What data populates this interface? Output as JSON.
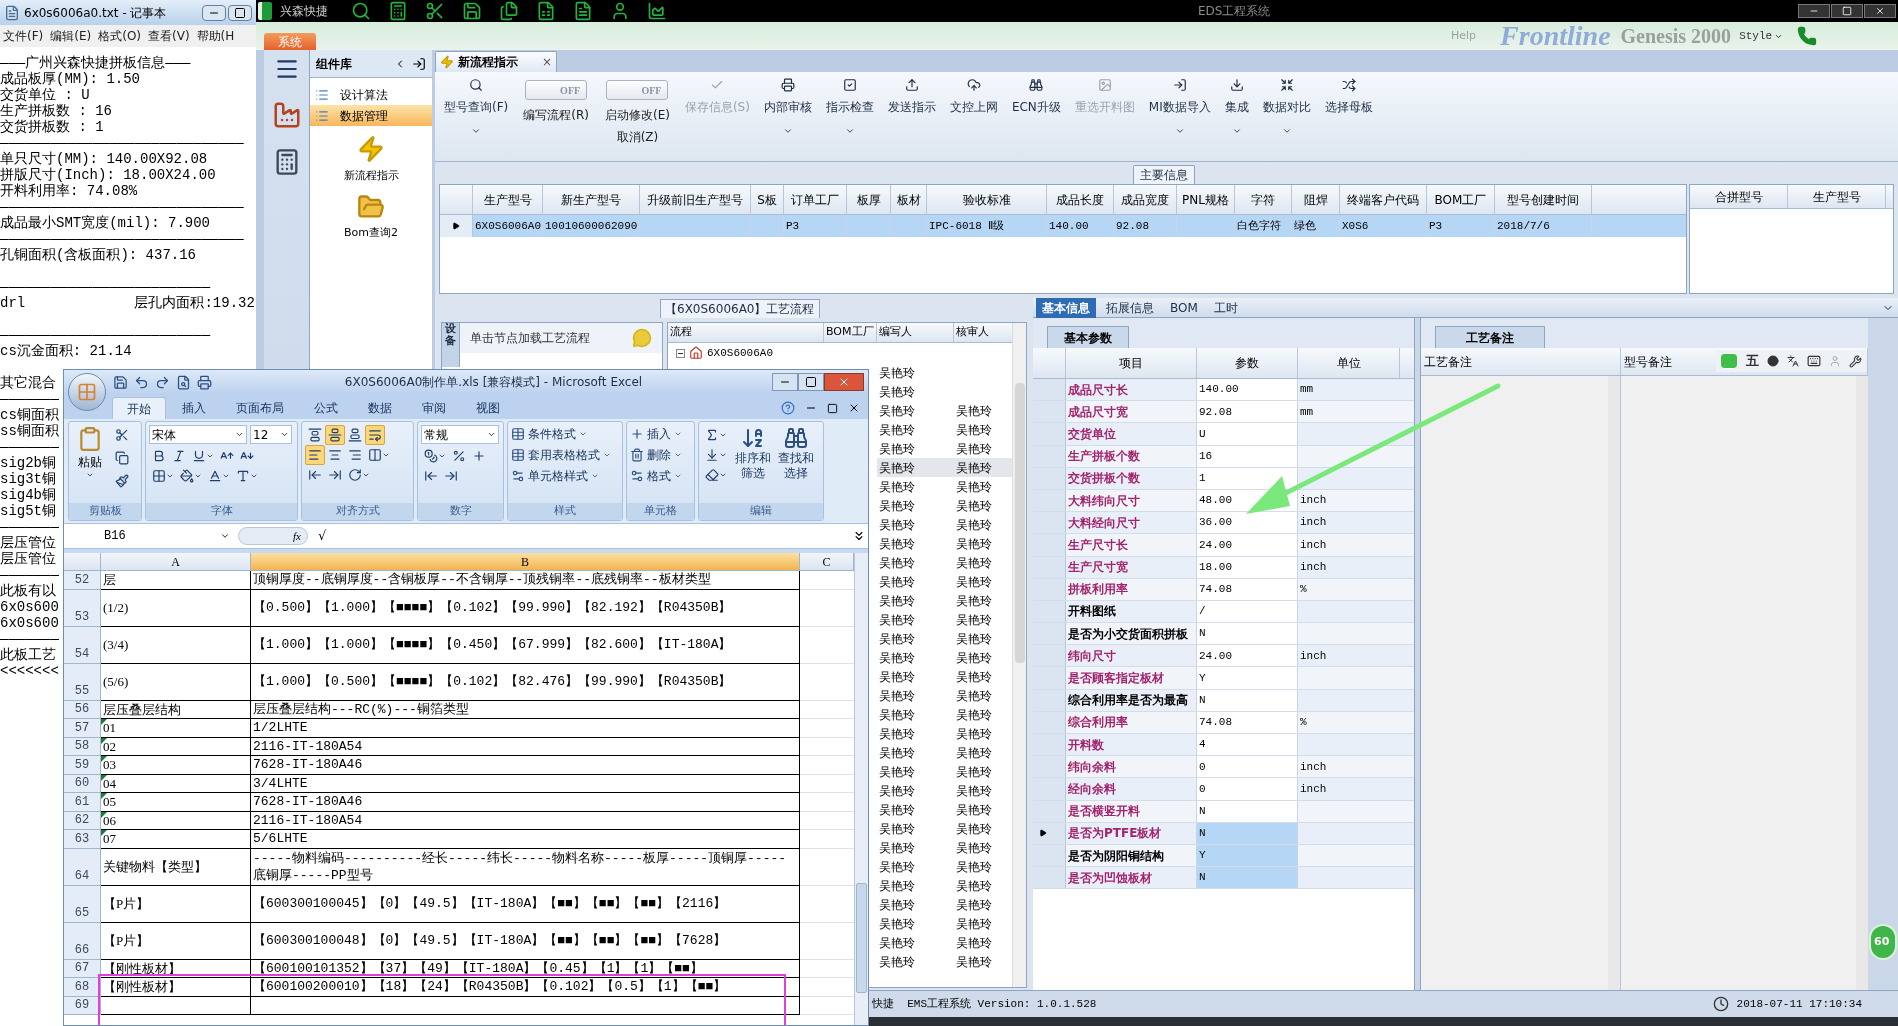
{
  "notepad": {
    "title": "6x0s6006a0.txt - 记事本",
    "menu": [
      "文件(F)",
      "编辑(E)",
      "格式(O)",
      "查看(V)",
      "帮助(H"
    ],
    "lines": [
      {
        "kind": "text",
        "text": "———广州兴森快捷拼板信息———"
      },
      {
        "kind": "text",
        "text": "成品板厚(MM): 1.50"
      },
      {
        "kind": "text",
        "text": "交货单位 : U"
      },
      {
        "kind": "text",
        "text": "生产拼板数 : 16"
      },
      {
        "kind": "text",
        "text": "交货拼板数 : 1"
      },
      {
        "kind": "text",
        "text": "—————————————————————————————"
      },
      {
        "kind": "text",
        "text": "单只尺寸(MM): 140.00X92.08"
      },
      {
        "kind": "text",
        "text": "拼版尺寸(Inch): 18.00X24.00"
      },
      {
        "kind": "text",
        "text": "开料利用率: 74.08%"
      },
      {
        "kind": "text",
        "text": "—————————————————————————————"
      },
      {
        "kind": "text",
        "text": "成品最小SMT宽度(mil): 7.900"
      },
      {
        "kind": "text",
        "text": "—————————————————————————————"
      },
      {
        "kind": "text",
        "text": "孔铜面积(含板面积): 437.16"
      },
      {
        "kind": "blank"
      },
      {
        "kind": "text",
        "text": "—————————————————————————"
      },
      {
        "kind": "text",
        "text": "drl             层孔内面积:19.32"
      },
      {
        "kind": "blank"
      },
      {
        "kind": "text",
        "text": "—————————————————————————"
      },
      {
        "kind": "text",
        "text": "cs沉金面积: 21.14"
      },
      {
        "kind": "blank"
      },
      {
        "kind": "text",
        "text": "其它混合"
      },
      {
        "kind": "text",
        "text": "———————"
      },
      {
        "kind": "text",
        "text": "cs铜面积"
      },
      {
        "kind": "text",
        "text": "ss铜面积"
      },
      {
        "kind": "text",
        "text": "———————"
      },
      {
        "kind": "text",
        "text": "sig2b铜"
      },
      {
        "kind": "text",
        "text": "sig3t铜"
      },
      {
        "kind": "text",
        "text": "sig4b铜"
      },
      {
        "kind": "text",
        "text": "sig5t铜"
      },
      {
        "kind": "text",
        "text": "———————"
      },
      {
        "kind": "text",
        "text": "层压管位"
      },
      {
        "kind": "text",
        "text": "层压管位"
      },
      {
        "kind": "text",
        "text": "———————"
      },
      {
        "kind": "text",
        "text": "此板有以"
      },
      {
        "kind": "text",
        "text": "6x0s600"
      },
      {
        "kind": "text",
        "text": "6x0s600"
      },
      {
        "kind": "text",
        "text": "———————"
      },
      {
        "kind": "text",
        "text": "此板工艺"
      },
      {
        "kind": "text",
        "text": "<<<<<<<"
      }
    ]
  },
  "app": {
    "brand": "兴森快捷",
    "window_title": "EDS工程系统",
    "system_tab": "系统",
    "help_menu": "Help",
    "banner_logo": "Frontline",
    "banner_product": "Genesis 2000",
    "style_menu": "Style"
  },
  "component_panel": {
    "title": "组件库",
    "items": [
      {
        "label": "设计算法",
        "selected": false
      },
      {
        "label": "数据管理",
        "selected": true
      }
    ],
    "launchers": [
      "新流程指示",
      "Bom查询2"
    ]
  },
  "document_tab": {
    "label": "新流程指示",
    "close": "×"
  },
  "toolbar": [
    {
      "kind": "button",
      "label": "型号查询(F)",
      "disabled": false,
      "dropdown": true
    },
    {
      "kind": "toggle",
      "label": "编写流程(R)",
      "switch_text": "OFF",
      "on": false
    },
    {
      "kind": "toggle",
      "label": "启动修改(E)",
      "extra_label": "取消(Z)",
      "switch_text": "OFF",
      "on": false
    },
    {
      "kind": "button",
      "label": "保存信息(S)",
      "disabled": true,
      "dropdown": false
    },
    {
      "kind": "button",
      "label": "内部审核",
      "disabled": false,
      "dropdown": true
    },
    {
      "kind": "button",
      "label": "指示检查",
      "disabled": false,
      "dropdown": true
    },
    {
      "kind": "button",
      "label": "发送指示",
      "disabled": false,
      "dropdown": false
    },
    {
      "kind": "button",
      "label": "文控上网",
      "disabled": false,
      "dropdown": false
    },
    {
      "kind": "button",
      "label": "ECN升级",
      "disabled": false,
      "dropdown": false
    },
    {
      "kind": "button",
      "label": "重选开料图",
      "disabled": true,
      "dropdown": false
    },
    {
      "kind": "button",
      "label": "MI数据导入",
      "disabled": false,
      "dropdown": true
    },
    {
      "kind": "button",
      "label": "集成",
      "disabled": false,
      "dropdown": true
    },
    {
      "kind": "button",
      "label": "数据对比",
      "disabled": false,
      "dropdown": true
    },
    {
      "kind": "button",
      "label": "选择母板",
      "disabled": false,
      "dropdown": false
    }
  ],
  "main_info": {
    "title": "主要信息",
    "columns": [
      "生产型号",
      "新生产型号",
      "升级前旧生产型号",
      "S板",
      "订单工厂",
      "板厚",
      "板材",
      "验收标准",
      "成品长度",
      "成品宽度",
      "PNL规格",
      "字符",
      "阻焊",
      "终端客户代码",
      "BOM工厂",
      "型号创建时间"
    ],
    "rows": [
      {
        "selected": true,
        "cells": [
          "6X0S6006A0",
          "10010600062090",
          null,
          null,
          "P3",
          null,
          null,
          "IPC-6018 Ⅱ级",
          "140.00",
          "92.08",
          null,
          "白色字符",
          "绿色",
          "X0S6",
          "P3",
          "2018/7/6"
        ]
      }
    ],
    "side_columns": [
      "合拼型号",
      "生产型号"
    ]
  },
  "process": {
    "title": "【6X0S6006A0】工艺流程",
    "side_tab": "设备",
    "hint": "单击节点加载工艺流程",
    "columns": [
      "流程",
      "BOM工厂",
      "编写人",
      "核审人"
    ],
    "root": {
      "label": "6X0S6006A0",
      "expanded": true
    },
    "rows": [
      {
        "writer": "吴艳玲",
        "reviewer": null,
        "selected": false
      },
      {
        "writer": "吴艳玲",
        "reviewer": null,
        "selected": false
      },
      {
        "writer": "吴艳玲",
        "reviewer": "吴艳玲",
        "selected": false
      },
      {
        "writer": "吴艳玲",
        "reviewer": "吴艳玲",
        "selected": false
      },
      {
        "writer": "吴艳玲",
        "reviewer": "吴艳玲",
        "selected": false
      },
      {
        "writer": "吴艳玲",
        "reviewer": "吴艳玲",
        "selected": true
      },
      {
        "writer": "吴艳玲",
        "reviewer": "吴艳玲",
        "selected": false
      },
      {
        "writer": "吴艳玲",
        "reviewer": "吴艳玲",
        "selected": false
      },
      {
        "writer": "吴艳玲",
        "reviewer": "吴艳玲",
        "selected": false
      },
      {
        "writer": "吴艳玲",
        "reviewer": "吴艳玲",
        "selected": false
      },
      {
        "writer": "吴艳玲",
        "reviewer": "吴艳玲",
        "selected": false
      },
      {
        "writer": "吴艳玲",
        "reviewer": "吴艳玲",
        "selected": false
      },
      {
        "writer": "吴艳玲",
        "reviewer": "吴艳玲",
        "selected": false
      },
      {
        "writer": "吴艳玲",
        "reviewer": "吴艳玲",
        "selected": false
      },
      {
        "writer": "吴艳玲",
        "reviewer": "吴艳玲",
        "selected": false
      },
      {
        "writer": "吴艳玲",
        "reviewer": "吴艳玲",
        "selected": false
      },
      {
        "writer": "吴艳玲",
        "reviewer": "吴艳玲",
        "selected": false
      },
      {
        "writer": "吴艳玲",
        "reviewer": "吴艳玲",
        "selected": false
      },
      {
        "writer": "吴艳玲",
        "reviewer": "吴艳玲",
        "selected": false
      },
      {
        "writer": "吴艳玲",
        "reviewer": "吴艳玲",
        "selected": false
      },
      {
        "writer": "吴艳玲",
        "reviewer": "吴艳玲",
        "selected": false
      },
      {
        "writer": "吴艳玲",
        "reviewer": "吴艳玲",
        "selected": false
      },
      {
        "writer": "吴艳玲",
        "reviewer": "吴艳玲",
        "selected": false
      },
      {
        "writer": "吴艳玲",
        "reviewer": "吴艳玲",
        "selected": false
      },
      {
        "writer": "吴艳玲",
        "reviewer": "吴艳玲",
        "selected": false
      },
      {
        "writer": "吴艳玲",
        "reviewer": "吴艳玲",
        "selected": false
      },
      {
        "writer": "吴艳玲",
        "reviewer": "吴艳玲",
        "selected": false
      },
      {
        "writer": "吴艳玲",
        "reviewer": "吴艳玲",
        "selected": false
      },
      {
        "writer": "吴艳玲",
        "reviewer": "吴艳玲",
        "selected": false
      },
      {
        "writer": "吴艳玲",
        "reviewer": "吴艳玲",
        "selected": false
      },
      {
        "writer": "吴艳玲",
        "reviewer": "吴艳玲",
        "selected": false
      },
      {
        "writer": "吴艳玲",
        "reviewer": "吴艳玲",
        "selected": false
      }
    ]
  },
  "detail_tabs": [
    {
      "label": "基本信息",
      "selected": true
    },
    {
      "label": "拓展信息",
      "selected": false
    },
    {
      "label": "BOM",
      "selected": false
    },
    {
      "label": "工时",
      "selected": false
    }
  ],
  "params": {
    "tab": "基本参数",
    "columns": [
      "项目",
      "参数",
      "单位"
    ],
    "rows": [
      {
        "item": "成品尺寸长",
        "value": "140.00",
        "unit": "mm",
        "color": "#a3246e",
        "selected": false,
        "current": false
      },
      {
        "item": "成品尺寸宽",
        "value": "92.08",
        "unit": "mm",
        "color": "#a3246e",
        "selected": false,
        "current": false
      },
      {
        "item": "交货单位",
        "value": "U",
        "color": "#a3246e",
        "selected": false,
        "current": false
      },
      {
        "item": "生产拼板个数",
        "value": "16",
        "color": "#a3246e",
        "selected": false,
        "current": false
      },
      {
        "item": "交货拼板个数",
        "value": "1",
        "color": "#a3246e",
        "selected": false,
        "current": false
      },
      {
        "item": "大料纬向尺寸",
        "value": "48.00",
        "unit": "inch",
        "color": "#a3246e",
        "selected": false,
        "current": false
      },
      {
        "item": "大料经向尺寸",
        "value": "36.00",
        "unit": "inch",
        "color": "#a3246e",
        "selected": false,
        "current": false
      },
      {
        "item": "生产尺寸长",
        "value": "24.00",
        "unit": "inch",
        "color": "#a3246e",
        "selected": false,
        "current": false
      },
      {
        "item": "生产尺寸宽",
        "value": "18.00",
        "unit": "inch",
        "color": "#a3246e",
        "selected": false,
        "current": false
      },
      {
        "item": "拼板利用率",
        "value": "74.08",
        "unit": "%",
        "color": "#a3246e",
        "selected": false,
        "current": false
      },
      {
        "item": "开料图纸",
        "value": "/",
        "color": "#000000",
        "selected": false,
        "current": false
      },
      {
        "item": "是否为小交货面积拼板",
        "value": "N",
        "color": "#000000",
        "selected": false,
        "current": false
      },
      {
        "item": "纬向尺寸",
        "value": "24.00",
        "unit": "inch",
        "color": "#a3246e",
        "selected": false,
        "current": false
      },
      {
        "item": "是否顾客指定板材",
        "value": "Y",
        "color": "#a3246e",
        "selected": false,
        "current": false
      },
      {
        "item": "综合利用率是否为最高",
        "value": "N",
        "color": "#000000",
        "selected": false,
        "current": false
      },
      {
        "item": "综合利用率",
        "value": "74.08",
        "unit": "%",
        "color": "#a3246e",
        "selected": false,
        "current": false
      },
      {
        "item": "开料数",
        "value": "4",
        "color": "#a3246e",
        "selected": false,
        "current": false
      },
      {
        "item": "纬向余料",
        "value": "0",
        "unit": "inch",
        "color": "#a3246e",
        "selected": false,
        "current": false
      },
      {
        "item": "经向余料",
        "value": "0",
        "unit": "inch",
        "color": "#a3246e",
        "selected": false,
        "current": false
      },
      {
        "item": "是否横竖开料",
        "value": "N",
        "color": "#a3246e",
        "selected": false,
        "current": false
      },
      {
        "item": "是否为PTFE板材",
        "value": "N",
        "color": "#a3246e",
        "selected": true,
        "current": true
      },
      {
        "item": "是否为阴阳铜结构",
        "value": "Y",
        "color": "#000000",
        "selected": true,
        "current": false
      },
      {
        "item": "是否为凹蚀板材",
        "value": "N",
        "color": "#a3246e",
        "selected": true,
        "current": false
      }
    ]
  },
  "notes": {
    "tab": "工艺备注",
    "columns": [
      "工艺备注",
      "型号备注"
    ],
    "ime_mode": "五"
  },
  "status_bar": {
    "version_text": "快捷  EMS工程系统 Version: 1.0.1.528",
    "datetime": "2018-07-11 17:10:34"
  },
  "badge": "60",
  "excel": {
    "title": "6X0S6006A0制作单.xls  [兼容模式] - Microsoft Excel",
    "tabs": [
      {
        "label": "开始",
        "selected": true
      },
      {
        "label": "插入",
        "selected": false
      },
      {
        "label": "页面布局",
        "selected": false
      },
      {
        "label": "公式",
        "selected": false
      },
      {
        "label": "数据",
        "selected": false
      },
      {
        "label": "审阅",
        "selected": false
      },
      {
        "label": "视图",
        "selected": false
      }
    ],
    "groups": [
      "剪贴板",
      "字体",
      "对齐方式",
      "数字",
      "样式",
      "单元格",
      "编辑"
    ],
    "paste_label": "粘贴",
    "font_name": "宋体",
    "font_size": "12",
    "number_format": "常规",
    "alignment": {
      "top": false,
      "middle": true,
      "bottom": false,
      "left": true,
      "center": false,
      "right": false,
      "wrap_text": true
    },
    "style_buttons": [
      "条件格式",
      "套用表格格式",
      "单元格样式"
    ],
    "cell_buttons": [
      "插入",
      "删除",
      "格式"
    ],
    "sort_label": "排序和筛选",
    "find_label": "查找和选择",
    "name_box": "B16",
    "fx": "fx",
    "formula": "√",
    "columns": [
      {
        "label": "A",
        "selected": false
      },
      {
        "label": "B",
        "selected": true
      },
      {
        "label": "C",
        "selected": false
      }
    ],
    "rows": [
      {
        "number": "52",
        "a": "层",
        "b": "顶铜厚度--底铜厚度--含铜板厚--不含铜厚--顶残铜率--底残铜率--板材类型",
        "wrapped": false,
        "text_number": false
      },
      {
        "number": "53",
        "a": "(1/2)",
        "b": "【0.500】【1.000】【■■■■】【0.102】【99.990】【82.192】【R04350B】",
        "wrapped": true,
        "text_number": false
      },
      {
        "number": "54",
        "a": "(3/4)",
        "b": "【1.000】【1.000】【■■■■】【0.450】【67.999】【82.600】【IT-180A】",
        "wrapped": true,
        "text_number": false
      },
      {
        "number": "55",
        "a": "(5/6)",
        "b": "【1.000】【0.500】【■■■■】【0.102】【82.476】【99.990】【R04350B】",
        "wrapped": true,
        "text_number": false
      },
      {
        "number": "56",
        "a": "层压叠层结构",
        "b": "层压叠层结构---RC(%)---铜箔类型",
        "wrapped": false,
        "text_number": false
      },
      {
        "number": "57",
        "a": "01",
        "b": "1/2LHTE",
        "wrapped": false,
        "text_number": true
      },
      {
        "number": "58",
        "a": "02",
        "b": "2116-IT-180A54",
        "wrapped": false,
        "text_number": true
      },
      {
        "number": "59",
        "a": "03",
        "b": "7628-IT-180A46",
        "wrapped": false,
        "text_number": true
      },
      {
        "number": "60",
        "a": "04",
        "b": "3/4LHTE",
        "wrapped": false,
        "text_number": true
      },
      {
        "number": "61",
        "a": "05",
        "b": "7628-IT-180A46",
        "wrapped": false,
        "text_number": true
      },
      {
        "number": "62",
        "a": "06",
        "b": "2116-IT-180A54",
        "wrapped": false,
        "text_number": true
      },
      {
        "number": "63",
        "a": "07",
        "b": "5/6LHTE",
        "wrapped": false,
        "text_number": true
      },
      {
        "number": "64",
        "a": "关键物料【类型】",
        "b": "-----物料编码----------经长-----纬长-----物料名称-----板厚-----顶铜厚-----底铜厚-----PP型号",
        "wrapped": true,
        "text_number": false
      },
      {
        "number": "65",
        "a": "【P片】",
        "b": "【600300100045】【0】【49.5】【IT-180A】【■■】【■■】【■■】【2116】",
        "wrapped": true,
        "text_number": false
      },
      {
        "number": "66",
        "a": "【P片】",
        "b": "【600300100048】【0】【49.5】【IT-180A】【■■】【■■】【■■】【7628】",
        "wrapped": true,
        "text_number": false
      },
      {
        "number": "67",
        "a": "【刚性板材】",
        "b": "【600100101352】【37】【49】【IT-180A】【0.45】【1】【1】【■■】",
        "wrapped": false,
        "text_number": false
      },
      {
        "number": "68",
        "a": "【刚性板材】",
        "b": "【600100200010】【18】【24】【R04350B】【0.102】【0.5】【1】【■■】",
        "wrapped": false,
        "text_number": false
      },
      {
        "number": "69",
        "wrapped": false,
        "text_number": false
      }
    ]
  }
}
